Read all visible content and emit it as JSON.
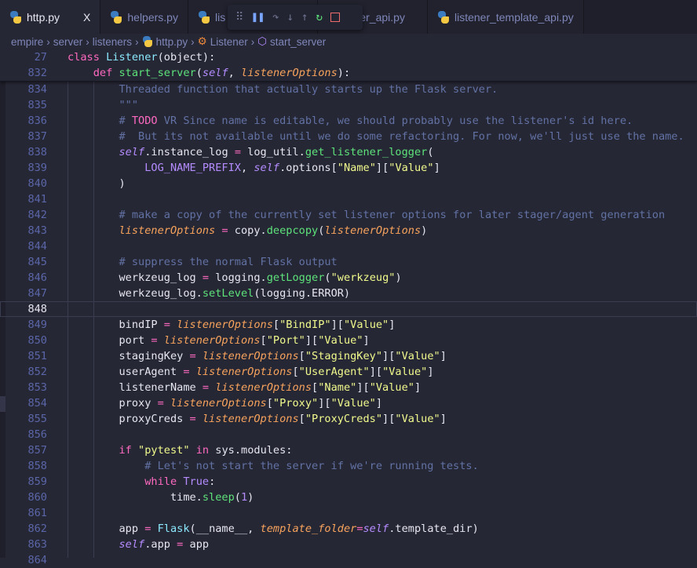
{
  "tabs": [
    {
      "label": "http.py",
      "active": true,
      "icon": "python-icon",
      "close": "X"
    },
    {
      "label": "helpers.py",
      "icon": "python-icon"
    },
    {
      "label": "lis",
      "icon": "python-icon"
    },
    {
      "label": "ner_api.py"
    },
    {
      "label": "listener_template_api.py",
      "icon": "python-icon"
    }
  ],
  "debug_toolbar": {
    "grip": "⠿",
    "pause": "❚❚",
    "step_over": "↷",
    "step_into": "↓",
    "step_out": "↑",
    "restart": "↻"
  },
  "breadcrumb": [
    "empire",
    "server",
    "listeners",
    "http.py",
    "Listener",
    "start_server"
  ],
  "colors": {
    "background": "#262735",
    "keyword": "#ff6ac1",
    "function": "#5de37a",
    "string": "#f1fa8c",
    "comment": "#6272a4",
    "parameter": "#f7a35c",
    "self": "#b48cff"
  },
  "sticky": [
    {
      "n": "27",
      "t": [
        [
          "k",
          "class "
        ],
        [
          "c",
          "Listener"
        ],
        [
          "",
          "(object):"
        ]
      ]
    },
    {
      "n": "832",
      "t": [
        [
          "",
          "    "
        ],
        [
          "k",
          "def "
        ],
        [
          "f",
          "start_server"
        ],
        [
          "",
          "("
        ],
        [
          "self",
          "self"
        ],
        [
          "",
          ", "
        ],
        [
          "p",
          "listenerOptions"
        ],
        [
          "",
          "):"
        ]
      ]
    }
  ],
  "current_line": "848",
  "lines": [
    {
      "n": "834",
      "t": [
        [
          "cm",
          "        Threaded function that actually starts up the Flask server."
        ]
      ]
    },
    {
      "n": "835",
      "t": [
        [
          "cm",
          "        \"\"\""
        ]
      ]
    },
    {
      "n": "836",
      "t": [
        [
          "cm",
          "        # "
        ],
        [
          "todo",
          "TODO"
        ],
        [
          "cm",
          " VR Since name is editable, we should probably use the listener's id here."
        ]
      ]
    },
    {
      "n": "837",
      "t": [
        [
          "cm",
          "        #  But its not available until we do some refactoring. For now, we'll just use the name."
        ]
      ]
    },
    {
      "n": "838",
      "t": [
        [
          "",
          "        "
        ],
        [
          "self",
          "self"
        ],
        [
          "",
          ".instance_log "
        ],
        [
          "k",
          "="
        ],
        [
          "",
          " log_util."
        ],
        [
          "f",
          "get_listener_logger"
        ],
        [
          "",
          "("
        ]
      ]
    },
    {
      "n": "839",
      "t": [
        [
          "",
          "            "
        ],
        [
          "n",
          "LOG_NAME_PREFIX"
        ],
        [
          "",
          ", "
        ],
        [
          "self",
          "self"
        ],
        [
          "",
          ".options["
        ],
        [
          "s",
          "\"Name\""
        ],
        [
          "",
          "]["
        ],
        [
          "s",
          "\"Value\""
        ],
        [
          "",
          "]"
        ]
      ]
    },
    {
      "n": "840",
      "t": [
        [
          "",
          "        )"
        ]
      ]
    },
    {
      "n": "841",
      "t": []
    },
    {
      "n": "842",
      "t": [
        [
          "cm",
          "        # make a copy of the currently set listener options for later stager/agent generation"
        ]
      ]
    },
    {
      "n": "843",
      "t": [
        [
          "",
          "        "
        ],
        [
          "p",
          "listenerOptions"
        ],
        [
          "k",
          " ="
        ],
        [
          "",
          " copy."
        ],
        [
          "f",
          "deepcopy"
        ],
        [
          "",
          "("
        ],
        [
          "p",
          "listenerOptions"
        ],
        [
          "",
          ")"
        ]
      ]
    },
    {
      "n": "844",
      "t": []
    },
    {
      "n": "845",
      "t": [
        [
          "cm",
          "        # suppress the normal Flask output"
        ]
      ]
    },
    {
      "n": "846",
      "t": [
        [
          "",
          "        werkzeug_log "
        ],
        [
          "k",
          "="
        ],
        [
          "",
          " logging."
        ],
        [
          "f",
          "getLogger"
        ],
        [
          "",
          "("
        ],
        [
          "s",
          "\"werkzeug\""
        ],
        [
          "",
          ")"
        ]
      ]
    },
    {
      "n": "847",
      "t": [
        [
          "",
          "        werkzeug_log."
        ],
        [
          "f",
          "setLevel"
        ],
        [
          "",
          "(logging.ERROR)"
        ]
      ]
    },
    {
      "n": "848",
      "t": []
    },
    {
      "n": "849",
      "t": [
        [
          "",
          "        bindIP "
        ],
        [
          "k",
          "="
        ],
        [
          "p",
          " listenerOptions"
        ],
        [
          "",
          "["
        ],
        [
          "s",
          "\"BindIP\""
        ],
        [
          "",
          "]["
        ],
        [
          "s",
          "\"Value\""
        ],
        [
          "",
          "]"
        ]
      ]
    },
    {
      "n": "850",
      "t": [
        [
          "",
          "        port "
        ],
        [
          "k",
          "="
        ],
        [
          "p",
          " listenerOptions"
        ],
        [
          "",
          "["
        ],
        [
          "s",
          "\"Port\""
        ],
        [
          "",
          "]["
        ],
        [
          "s",
          "\"Value\""
        ],
        [
          "",
          "]"
        ]
      ]
    },
    {
      "n": "851",
      "t": [
        [
          "",
          "        stagingKey "
        ],
        [
          "k",
          "="
        ],
        [
          "p",
          " listenerOptions"
        ],
        [
          "",
          "["
        ],
        [
          "s",
          "\"StagingKey\""
        ],
        [
          "",
          "]["
        ],
        [
          "s",
          "\"Value\""
        ],
        [
          "",
          "]"
        ]
      ]
    },
    {
      "n": "852",
      "t": [
        [
          "",
          "        userAgent "
        ],
        [
          "k",
          "="
        ],
        [
          "p",
          " listenerOptions"
        ],
        [
          "",
          "["
        ],
        [
          "s",
          "\"UserAgent\""
        ],
        [
          "",
          "]["
        ],
        [
          "s",
          "\"Value\""
        ],
        [
          "",
          "]"
        ]
      ]
    },
    {
      "n": "853",
      "t": [
        [
          "",
          "        listenerName "
        ],
        [
          "k",
          "="
        ],
        [
          "p",
          " listenerOptions"
        ],
        [
          "",
          "["
        ],
        [
          "s",
          "\"Name\""
        ],
        [
          "",
          "]["
        ],
        [
          "s",
          "\"Value\""
        ],
        [
          "",
          "]"
        ]
      ]
    },
    {
      "n": "854",
      "t": [
        [
          "",
          "        proxy "
        ],
        [
          "k",
          "="
        ],
        [
          "p",
          " listenerOptions"
        ],
        [
          "",
          "["
        ],
        [
          "s",
          "\"Proxy\""
        ],
        [
          "",
          "]["
        ],
        [
          "s",
          "\"Value\""
        ],
        [
          "",
          "]"
        ]
      ]
    },
    {
      "n": "855",
      "t": [
        [
          "",
          "        proxyCreds "
        ],
        [
          "k",
          "="
        ],
        [
          "p",
          " listenerOptions"
        ],
        [
          "",
          "["
        ],
        [
          "s",
          "\"ProxyCreds\""
        ],
        [
          "",
          "]["
        ],
        [
          "s",
          "\"Value\""
        ],
        [
          "",
          "]"
        ]
      ]
    },
    {
      "n": "856",
      "t": []
    },
    {
      "n": "857",
      "t": [
        [
          "",
          "        "
        ],
        [
          "k",
          "if "
        ],
        [
          "s",
          "\"pytest\""
        ],
        [
          "k",
          " in"
        ],
        [
          "",
          " sys.modules:"
        ]
      ]
    },
    {
      "n": "858",
      "t": [
        [
          "cm",
          "            # Let's not start the server if we're running tests."
        ]
      ]
    },
    {
      "n": "859",
      "t": [
        [
          "",
          "            "
        ],
        [
          "k",
          "while "
        ],
        [
          "cn",
          "True"
        ],
        [
          "",
          ":"
        ]
      ]
    },
    {
      "n": "860",
      "t": [
        [
          "",
          "                time."
        ],
        [
          "f",
          "sleep"
        ],
        [
          "",
          "("
        ],
        [
          "n",
          "1"
        ],
        [
          "",
          ")"
        ]
      ]
    },
    {
      "n": "861",
      "t": []
    },
    {
      "n": "862",
      "t": [
        [
          "",
          "        app "
        ],
        [
          "k",
          "="
        ],
        [
          "",
          " "
        ],
        [
          "c",
          "Flask"
        ],
        [
          "",
          "(__name__, "
        ],
        [
          "p",
          "template_folder"
        ],
        [
          "k",
          "="
        ],
        [
          "self",
          "self"
        ],
        [
          "",
          ".template_dir)"
        ]
      ]
    },
    {
      "n": "863",
      "t": [
        [
          "",
          "        "
        ],
        [
          "self",
          "self"
        ],
        [
          "",
          ".app "
        ],
        [
          "k",
          "="
        ],
        [
          "",
          " app"
        ]
      ]
    },
    {
      "n": "864",
      "t": []
    }
  ]
}
